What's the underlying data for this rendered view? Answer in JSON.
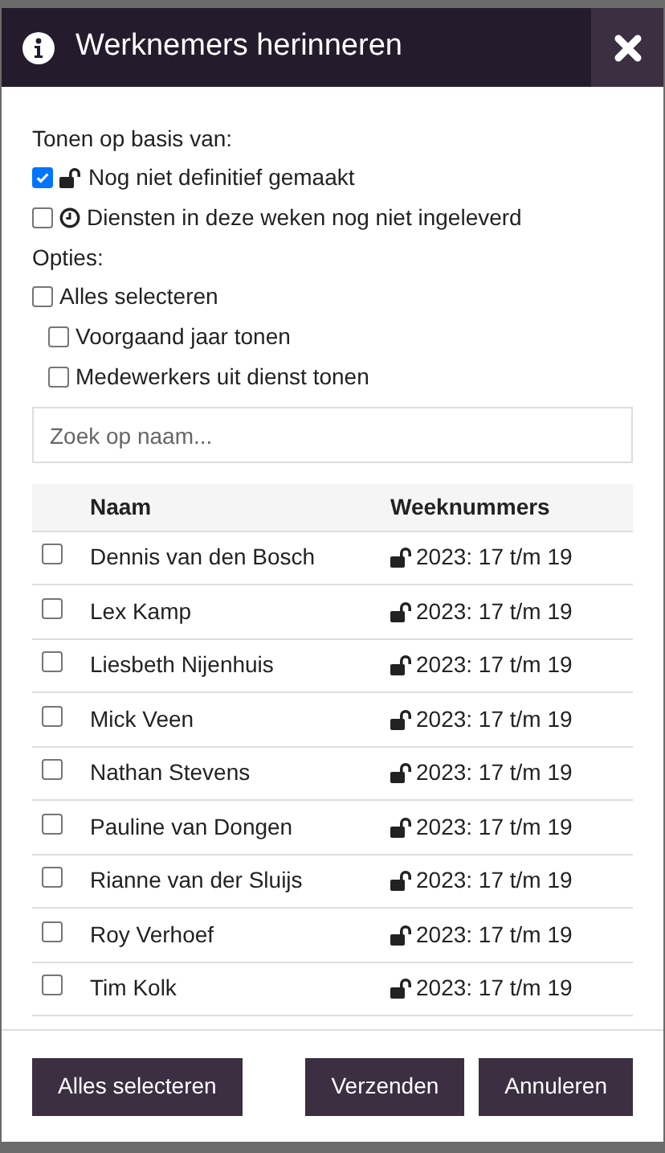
{
  "dialog": {
    "title": "Werknemers herinneren"
  },
  "filter_heading": "Tonen op basis van:",
  "filters": [
    {
      "label": "Nog niet definitief gemaakt",
      "kind": "unlocked",
      "checked": true
    },
    {
      "label": "Diensten in deze weken nog niet ingeleverd",
      "kind": "clock",
      "checked": false
    }
  ],
  "options_heading": "Opties:",
  "options": [
    {
      "label": "Alles selecteren",
      "checked": false,
      "children": [
        {
          "label": "Voorgaand jaar tonen",
          "checked": false
        },
        {
          "label": "Medewerkers uit dienst tonen",
          "checked": false
        }
      ]
    }
  ],
  "search": {
    "placeholder": "Zoek op naam..."
  },
  "table": {
    "columns": [
      "Naam",
      "Weeknummers"
    ],
    "rows": [
      {
        "name": "Dennis van den Bosch",
        "weeks": "2023: 17 t/m 19",
        "checked": false
      },
      {
        "name": "Lex Kamp",
        "weeks": "2023: 17 t/m 19",
        "checked": false
      },
      {
        "name": "Liesbeth Nijenhuis",
        "weeks": "2023: 17 t/m 19",
        "checked": false
      },
      {
        "name": "Mick Veen",
        "weeks": "2023: 17 t/m 19",
        "checked": false
      },
      {
        "name": "Nathan Stevens",
        "weeks": "2023: 17 t/m 19",
        "checked": false
      },
      {
        "name": "Pauline van Dongen",
        "weeks": "2023: 17 t/m 19",
        "checked": false
      },
      {
        "name": "Rianne van der Sluijs",
        "weeks": "2023: 17 t/m 19",
        "checked": false
      },
      {
        "name": "Roy Verhoef",
        "weeks": "2023: 17 t/m 19",
        "checked": false
      },
      {
        "name": "Tim Kolk",
        "weeks": "2023: 17 t/m 19",
        "checked": false
      }
    ]
  },
  "buttons": [
    "Alles selecteren",
    "Verzenden",
    "Annuleren"
  ]
}
